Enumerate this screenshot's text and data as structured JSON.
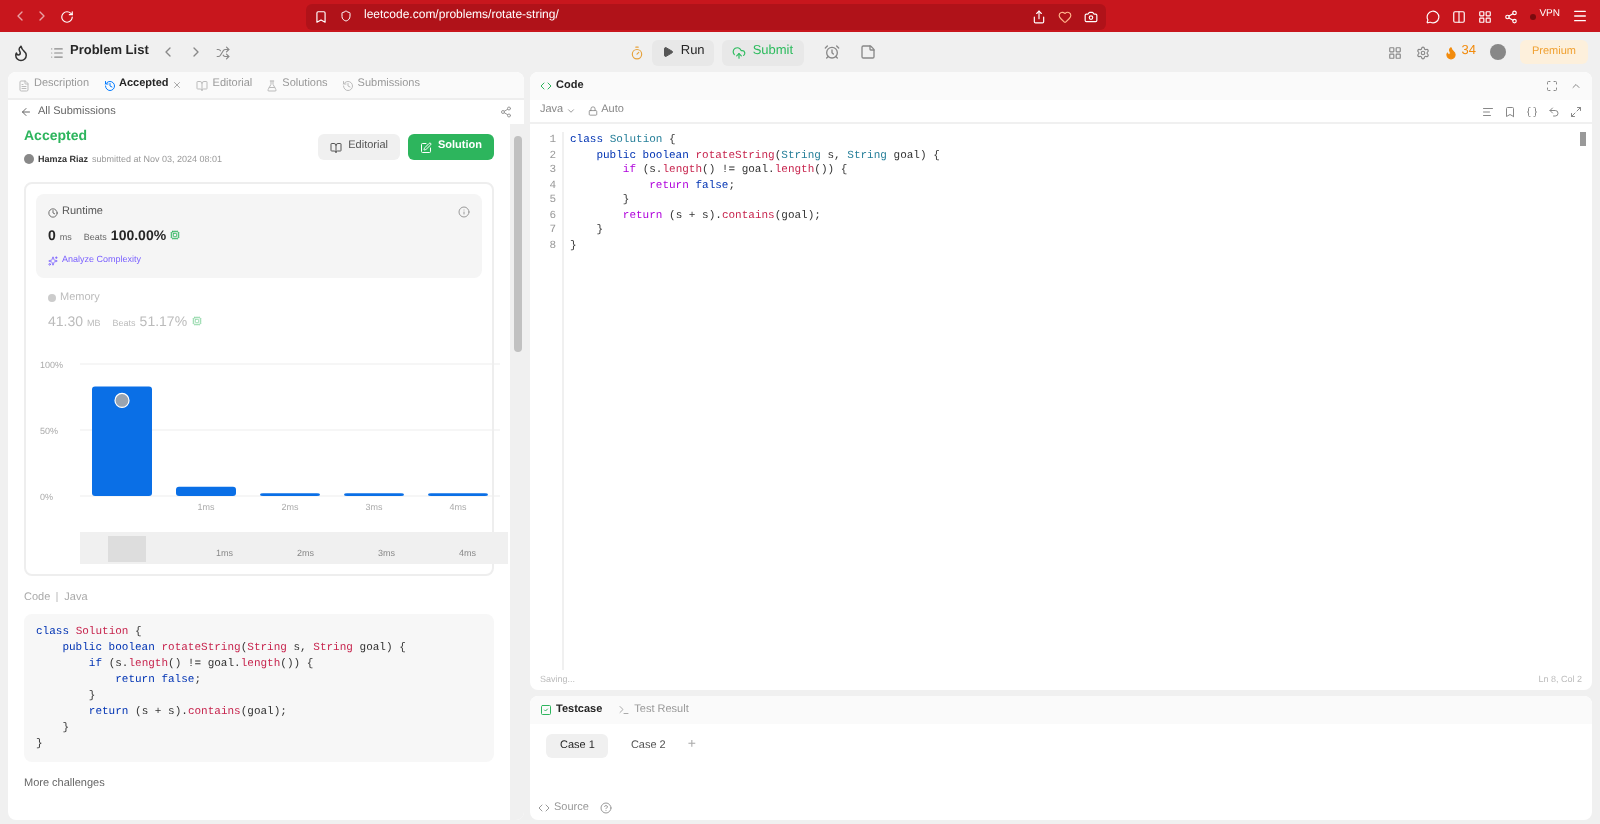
{
  "browser": {
    "url": "leetcode.com/problems/rotate-string/",
    "vpn": "VPN"
  },
  "toolbar": {
    "problem_list": "Problem List",
    "run": "Run",
    "submit": "Submit",
    "streak": "34",
    "premium": "Premium"
  },
  "left_tabs": [
    {
      "label": "Description",
      "selected": false,
      "closable": false
    },
    {
      "label": "Accepted",
      "selected": true,
      "closable": true
    },
    {
      "label": "Editorial",
      "selected": false,
      "closable": false
    },
    {
      "label": "Solutions",
      "selected": false,
      "closable": false
    },
    {
      "label": "Submissions",
      "selected": false,
      "closable": false
    }
  ],
  "back_link": "All Submissions",
  "submission": {
    "status": "Accepted",
    "user": "Hamza Riaz",
    "submitted": "submitted at Nov 03, 2024 08:01",
    "editorial_button": "Editorial",
    "solution_button": "Solution"
  },
  "runtime": {
    "title": "Runtime",
    "value": "0",
    "unit": "ms",
    "beats_label": "Beats",
    "beats": "100.00%",
    "analyze": "Analyze Complexity"
  },
  "memory": {
    "title": "Memory",
    "value": "41.30",
    "unit": "MB",
    "beats_label": "Beats",
    "beats": "51.17%"
  },
  "chart_data": {
    "type": "bar",
    "categories": [
      null,
      "1ms",
      "2ms",
      "3ms",
      "4ms"
    ],
    "values": [
      83,
      7,
      2,
      2,
      2
    ],
    "ylim": [
      0,
      100
    ],
    "yticks": [
      {
        "value": 0,
        "label": "0%"
      },
      {
        "value": 50,
        "label": "50%"
      },
      {
        "value": 100,
        "label": "100%"
      }
    ]
  },
  "navigator": {
    "labels": [
      "1ms",
      "2ms",
      "3ms",
      "4ms"
    ]
  },
  "code_header": {
    "title": "Code",
    "language": "Java"
  },
  "submitted_code": [
    [
      {
        "text": "class ",
        "kind": "kw"
      },
      {
        "text": "Solution",
        "kind": "fn"
      },
      {
        "text": " {",
        "kind": "plain"
      }
    ],
    [
      {
        "text": "    public boolean ",
        "kind": "kw"
      },
      {
        "text": "rotateString",
        "kind": "fn"
      },
      {
        "text": "(",
        "kind": "plain"
      },
      {
        "text": "String",
        "kind": "fn"
      },
      {
        "text": " s, ",
        "kind": "plain"
      },
      {
        "text": "String",
        "kind": "fn"
      },
      {
        "text": " goal) {",
        "kind": "plain"
      }
    ],
    [
      {
        "text": "        if",
        "kind": "kw"
      },
      {
        "text": " (s.",
        "kind": "plain"
      },
      {
        "text": "length",
        "kind": "fn"
      },
      {
        "text": "() != goal.",
        "kind": "plain"
      },
      {
        "text": "length",
        "kind": "fn"
      },
      {
        "text": "()) {",
        "kind": "plain"
      }
    ],
    [
      {
        "text": "            return false",
        "kind": "kw"
      },
      {
        "text": ";",
        "kind": "plain"
      }
    ],
    [
      {
        "text": "        }",
        "kind": "plain"
      }
    ],
    [
      {
        "text": "        return",
        "kind": "kw"
      },
      {
        "text": " (s + s).",
        "kind": "plain"
      },
      {
        "text": "contains",
        "kind": "fn"
      },
      {
        "text": "(goal);",
        "kind": "plain"
      }
    ],
    [
      {
        "text": "    }",
        "kind": "plain"
      }
    ],
    [
      {
        "text": "}",
        "kind": "plain"
      }
    ]
  ],
  "more": "More challenges",
  "editor": {
    "title": "Code",
    "language": "Java",
    "mode": "Auto",
    "status": "Saving...",
    "cursor": "Ln 8, Col 2",
    "lines": [
      {
        "number": "1",
        "tokens": [
          {
            "text": "class ",
            "kind": "kw"
          },
          {
            "text": "Solution",
            "kind": "type"
          },
          {
            "text": " {",
            "kind": "plain"
          }
        ]
      },
      {
        "number": "2",
        "tokens": [
          {
            "text": "    public boolean ",
            "kind": "kw"
          },
          {
            "text": "rotateString",
            "kind": "fn"
          },
          {
            "text": "(",
            "kind": "plain"
          },
          {
            "text": "String",
            "kind": "type"
          },
          {
            "text": " s, ",
            "kind": "plain"
          },
          {
            "text": "String",
            "kind": "type"
          },
          {
            "text": " goal) {",
            "kind": "plain"
          }
        ]
      },
      {
        "number": "3",
        "tokens": [
          {
            "text": "        if",
            "kind": "ctrl"
          },
          {
            "text": " (s.",
            "kind": "plain"
          },
          {
            "text": "length",
            "kind": "fn"
          },
          {
            "text": "() != goal.",
            "kind": "plain"
          },
          {
            "text": "length",
            "kind": "fn"
          },
          {
            "text": "()) {",
            "kind": "plain"
          }
        ]
      },
      {
        "number": "4",
        "tokens": [
          {
            "text": "            return ",
            "kind": "ctrl"
          },
          {
            "text": "false",
            "kind": "kw"
          },
          {
            "text": ";",
            "kind": "plain"
          }
        ]
      },
      {
        "number": "5",
        "tokens": [
          {
            "text": "        }",
            "kind": "plain"
          }
        ]
      },
      {
        "number": "6",
        "tokens": [
          {
            "text": "        return",
            "kind": "ctrl"
          },
          {
            "text": " (s + s).",
            "kind": "plain"
          },
          {
            "text": "contains",
            "kind": "fn"
          },
          {
            "text": "(goal);",
            "kind": "plain"
          }
        ]
      },
      {
        "number": "7",
        "tokens": [
          {
            "text": "    }",
            "kind": "plain"
          }
        ]
      },
      {
        "number": "8",
        "tokens": [
          {
            "text": "}",
            "kind": "plain"
          }
        ]
      }
    ]
  },
  "bottom_tabs": [
    {
      "label": "Testcase",
      "selected": true
    },
    {
      "label": "Test Result",
      "selected": false
    }
  ],
  "cases": [
    {
      "label": "Case 1",
      "selected": true
    },
    {
      "label": "Case 2",
      "selected": false
    }
  ],
  "add_case": "+",
  "source": "Source"
}
